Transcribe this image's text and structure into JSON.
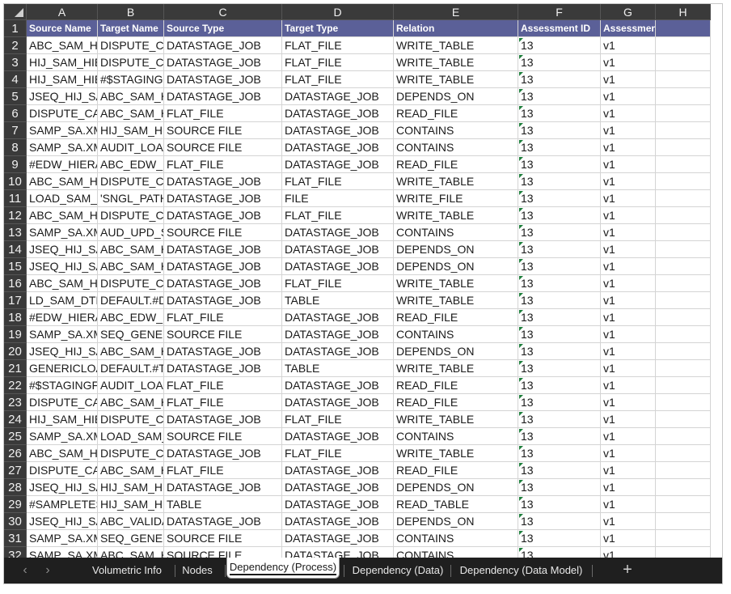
{
  "columns": [
    "A",
    "B",
    "C",
    "D",
    "E",
    "F",
    "G",
    "H"
  ],
  "header": [
    "Source Name",
    "Target Name",
    "Source Type",
    "Target Type",
    "Relation",
    "Assessment ID",
    "Assessment Version",
    ""
  ],
  "rows": [
    [
      "ABC_SAM_HIER",
      "DISPUTE_CA",
      "DATASTAGE_JOB",
      "FLAT_FILE",
      "WRITE_TABLE",
      "13",
      "v1"
    ],
    [
      "HIJ_SAM_HIER",
      "DISPUTE_CA",
      "DATASTAGE_JOB",
      "FLAT_FILE",
      "WRITE_TABLE",
      "13",
      "v1"
    ],
    [
      "HIJ_SAM_HIER",
      "#$STAGINGF",
      "DATASTAGE_JOB",
      "FLAT_FILE",
      "WRITE_TABLE",
      "13",
      "v1"
    ],
    [
      "JSEQ_HIJ_SAM",
      "ABC_SAM_HI",
      "DATASTAGE_JOB",
      "DATASTAGE_JOB",
      "DEPENDS_ON",
      "13",
      "v1"
    ],
    [
      "DISPUTE_CAS",
      "ABC_SAM_HI",
      "FLAT_FILE",
      "DATASTAGE_JOB",
      "READ_FILE",
      "13",
      "v1"
    ],
    [
      "SAMP_SA.XML",
      "HIJ_SAM_HIE",
      "SOURCE FILE",
      "DATASTAGE_JOB",
      "CONTAINS",
      "13",
      "v1"
    ],
    [
      "SAMP_SA.XML",
      "AUDIT_LOAD",
      "SOURCE FILE",
      "DATASTAGE_JOB",
      "CONTAINS",
      "13",
      "v1"
    ],
    [
      "#EDW_HIERA",
      "ABC_EDW_H",
      "FLAT_FILE",
      "DATASTAGE_JOB",
      "READ_FILE",
      "13",
      "v1"
    ],
    [
      "ABC_SAM_HIER",
      "DISPUTE_CA",
      "DATASTAGE_JOB",
      "FLAT_FILE",
      "WRITE_TABLE",
      "13",
      "v1"
    ],
    [
      "LOAD_SAM_H",
      "'SNGL_PATH_",
      "DATASTAGE_JOB",
      "FILE",
      "WRITE_FILE",
      "13",
      "v1"
    ],
    [
      "ABC_SAM_HIER",
      "DISPUTE_CA",
      "DATASTAGE_JOB",
      "FLAT_FILE",
      "WRITE_TABLE",
      "13",
      "v1"
    ],
    [
      "SAMP_SA.XML",
      "AUD_UPD_SI",
      "SOURCE FILE",
      "DATASTAGE_JOB",
      "CONTAINS",
      "13",
      "v1"
    ],
    [
      "JSEQ_HIJ_SAM",
      "ABC_SAM_HI",
      "DATASTAGE_JOB",
      "DATASTAGE_JOB",
      "DEPENDS_ON",
      "13",
      "v1"
    ],
    [
      "JSEQ_HIJ_SAM",
      "ABC_SAM_HI",
      "DATASTAGE_JOB",
      "DATASTAGE_JOB",
      "DEPENDS_ON",
      "13",
      "v1"
    ],
    [
      "ABC_SAM_HIER",
      "DISPUTE_CA",
      "DATASTAGE_JOB",
      "FLAT_FILE",
      "WRITE_TABLE",
      "13",
      "v1"
    ],
    [
      "LD_SAM_DTL",
      "DEFAULT.#D",
      "DATASTAGE_JOB",
      "TABLE",
      "WRITE_TABLE",
      "13",
      "v1"
    ],
    [
      "#EDW_HIERA",
      "ABC_EDW_H",
      "FLAT_FILE",
      "DATASTAGE_JOB",
      "READ_FILE",
      "13",
      "v1"
    ],
    [
      "SAMP_SA.XML",
      "SEQ_GENERI",
      "SOURCE FILE",
      "DATASTAGE_JOB",
      "CONTAINS",
      "13",
      "v1"
    ],
    [
      "JSEQ_HIJ_SAM",
      "ABC_SAM_HI",
      "DATASTAGE_JOB",
      "DATASTAGE_JOB",
      "DEPENDS_ON",
      "13",
      "v1"
    ],
    [
      "GENERICLOA",
      "DEFAULT.#T(",
      "DATASTAGE_JOB",
      "TABLE",
      "WRITE_TABLE",
      "13",
      "v1"
    ],
    [
      "#$STAGINGFI",
      "AUDIT_LOAD",
      "FLAT_FILE",
      "DATASTAGE_JOB",
      "READ_FILE",
      "13",
      "v1"
    ],
    [
      "DISPUTE_CAS",
      "ABC_SAM_HI",
      "FLAT_FILE",
      "DATASTAGE_JOB",
      "READ_FILE",
      "13",
      "v1"
    ],
    [
      "HIJ_SAM_HIER",
      "DISPUTE_CA",
      "DATASTAGE_JOB",
      "FLAT_FILE",
      "WRITE_TABLE",
      "13",
      "v1"
    ],
    [
      "SAMP_SA.XML",
      "LOAD_SAM_I",
      "SOURCE FILE",
      "DATASTAGE_JOB",
      "CONTAINS",
      "13",
      "v1"
    ],
    [
      "ABC_SAM_HIER",
      "DISPUTE_CA",
      "DATASTAGE_JOB",
      "FLAT_FILE",
      "WRITE_TABLE",
      "13",
      "v1"
    ],
    [
      "DISPUTE_CAS",
      "ABC_SAM_HI",
      "FLAT_FILE",
      "DATASTAGE_JOB",
      "READ_FILE",
      "13",
      "v1"
    ],
    [
      "JSEQ_HIJ_SAM",
      "HIJ_SAM_HIE",
      "DATASTAGE_JOB",
      "DATASTAGE_JOB",
      "DEPENDS_ON",
      "13",
      "v1"
    ],
    [
      "#SAMPLETES",
      "HIJ_SAM_HIE",
      "TABLE",
      "DATASTAGE_JOB",
      "READ_TABLE",
      "13",
      "v1"
    ],
    [
      "JSEQ_HIJ_SAM",
      "ABC_VALIDA",
      "DATASTAGE_JOB",
      "DATASTAGE_JOB",
      "DEPENDS_ON",
      "13",
      "v1"
    ],
    [
      "SAMP_SA.XML",
      "SEQ_GENERI",
      "SOURCE FILE",
      "DATASTAGE_JOB",
      "CONTAINS",
      "13",
      "v1"
    ],
    [
      "SAMP_SA.XML",
      "ABC_SAM_HI",
      "SOURCE FILE",
      "DATASTAGE_JOB",
      "CONTAINS",
      "13",
      "v1"
    ]
  ],
  "tabs": [
    {
      "label": "Volumetric Info",
      "active": false
    },
    {
      "label": "Nodes",
      "active": false
    },
    {
      "label": "Dependency (Process)",
      "active": true
    },
    {
      "label": "Dependency (Data)",
      "active": false
    },
    {
      "label": "Dependency (Data Model)",
      "active": false
    }
  ],
  "nav": {
    "prev_icon": "‹",
    "next_icon": "›",
    "add_icon": "+"
  },
  "colors": {
    "header_fill": "#5b6098",
    "text_number_flag": "#1e7f3c",
    "tab_bar": "#1f1f1f"
  }
}
